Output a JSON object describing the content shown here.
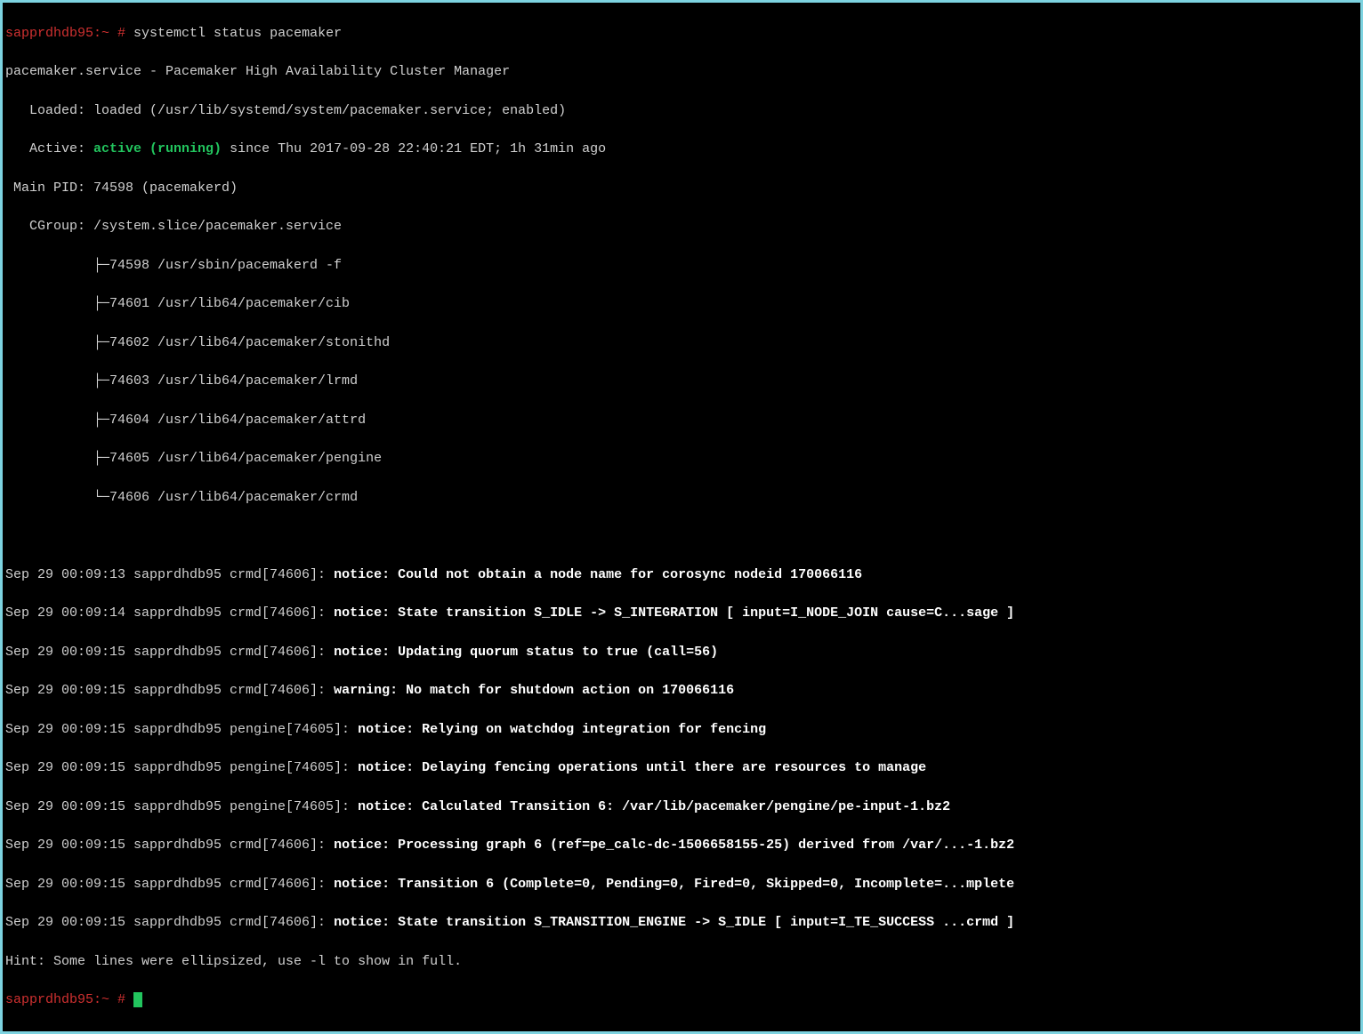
{
  "prompt1": {
    "host": "sapprdhdb95:~ ",
    "hash": "# ",
    "command": "systemctl status pacemaker"
  },
  "service": {
    "header": "pacemaker.service - Pacemaker High Availability Cluster Manager",
    "loaded": "   Loaded: loaded (/usr/lib/systemd/system/pacemaker.service; enabled)",
    "active_label": "   Active: ",
    "active_status": "active (running)",
    "active_since": " since Thu 2017-09-28 22:40:21 EDT; 1h 31min ago",
    "main_pid": " Main PID: 74598 (pacemakerd)",
    "cgroup_label": "   CGroup: /system.slice/pacemaker.service",
    "tree": [
      "           ├─74598 /usr/sbin/pacemakerd -f",
      "           ├─74601 /usr/lib64/pacemaker/cib",
      "           ├─74602 /usr/lib64/pacemaker/stonithd",
      "           ├─74603 /usr/lib64/pacemaker/lrmd",
      "           ├─74604 /usr/lib64/pacemaker/attrd",
      "           ├─74605 /usr/lib64/pacemaker/pengine",
      "           └─74606 /usr/lib64/pacemaker/crmd"
    ]
  },
  "blank": " ",
  "logs": [
    {
      "prefix": "Sep 29 00:09:13 sapprdhdb95 crmd[74606]: ",
      "msg": "notice: Could not obtain a node name for corosync nodeid 170066116"
    },
    {
      "prefix": "Sep 29 00:09:14 sapprdhdb95 crmd[74606]: ",
      "msg": "notice: State transition S_IDLE -> S_INTEGRATION [ input=I_NODE_JOIN cause=C...sage ]"
    },
    {
      "prefix": "Sep 29 00:09:15 sapprdhdb95 crmd[74606]: ",
      "msg": "notice: Updating quorum status to true (call=56)"
    },
    {
      "prefix": "Sep 29 00:09:15 sapprdhdb95 crmd[74606]: ",
      "msg": "warning: No match for shutdown action on 170066116"
    },
    {
      "prefix": "Sep 29 00:09:15 sapprdhdb95 pengine[74605]: ",
      "msg": "notice: Relying on watchdog integration for fencing"
    },
    {
      "prefix": "Sep 29 00:09:15 sapprdhdb95 pengine[74605]: ",
      "msg": "notice: Delaying fencing operations until there are resources to manage"
    },
    {
      "prefix": "Sep 29 00:09:15 sapprdhdb95 pengine[74605]: ",
      "msg": "notice: Calculated Transition 6: /var/lib/pacemaker/pengine/pe-input-1.bz2"
    },
    {
      "prefix": "Sep 29 00:09:15 sapprdhdb95 crmd[74606]: ",
      "msg": "notice: Processing graph 6 (ref=pe_calc-dc-1506658155-25) derived from /var/...-1.bz2"
    },
    {
      "prefix": "Sep 29 00:09:15 sapprdhdb95 crmd[74606]: ",
      "msg": "notice: Transition 6 (Complete=0, Pending=0, Fired=0, Skipped=0, Incomplete=...mplete"
    },
    {
      "prefix": "Sep 29 00:09:15 sapprdhdb95 crmd[74606]: ",
      "msg": "notice: State transition S_TRANSITION_ENGINE -> S_IDLE [ input=I_TE_SUCCESS ...crmd ]"
    }
  ],
  "hint": "Hint: Some lines were ellipsized, use -l to show in full.",
  "prompt2": {
    "host": "sapprdhdb95:~ ",
    "hash": "# "
  }
}
